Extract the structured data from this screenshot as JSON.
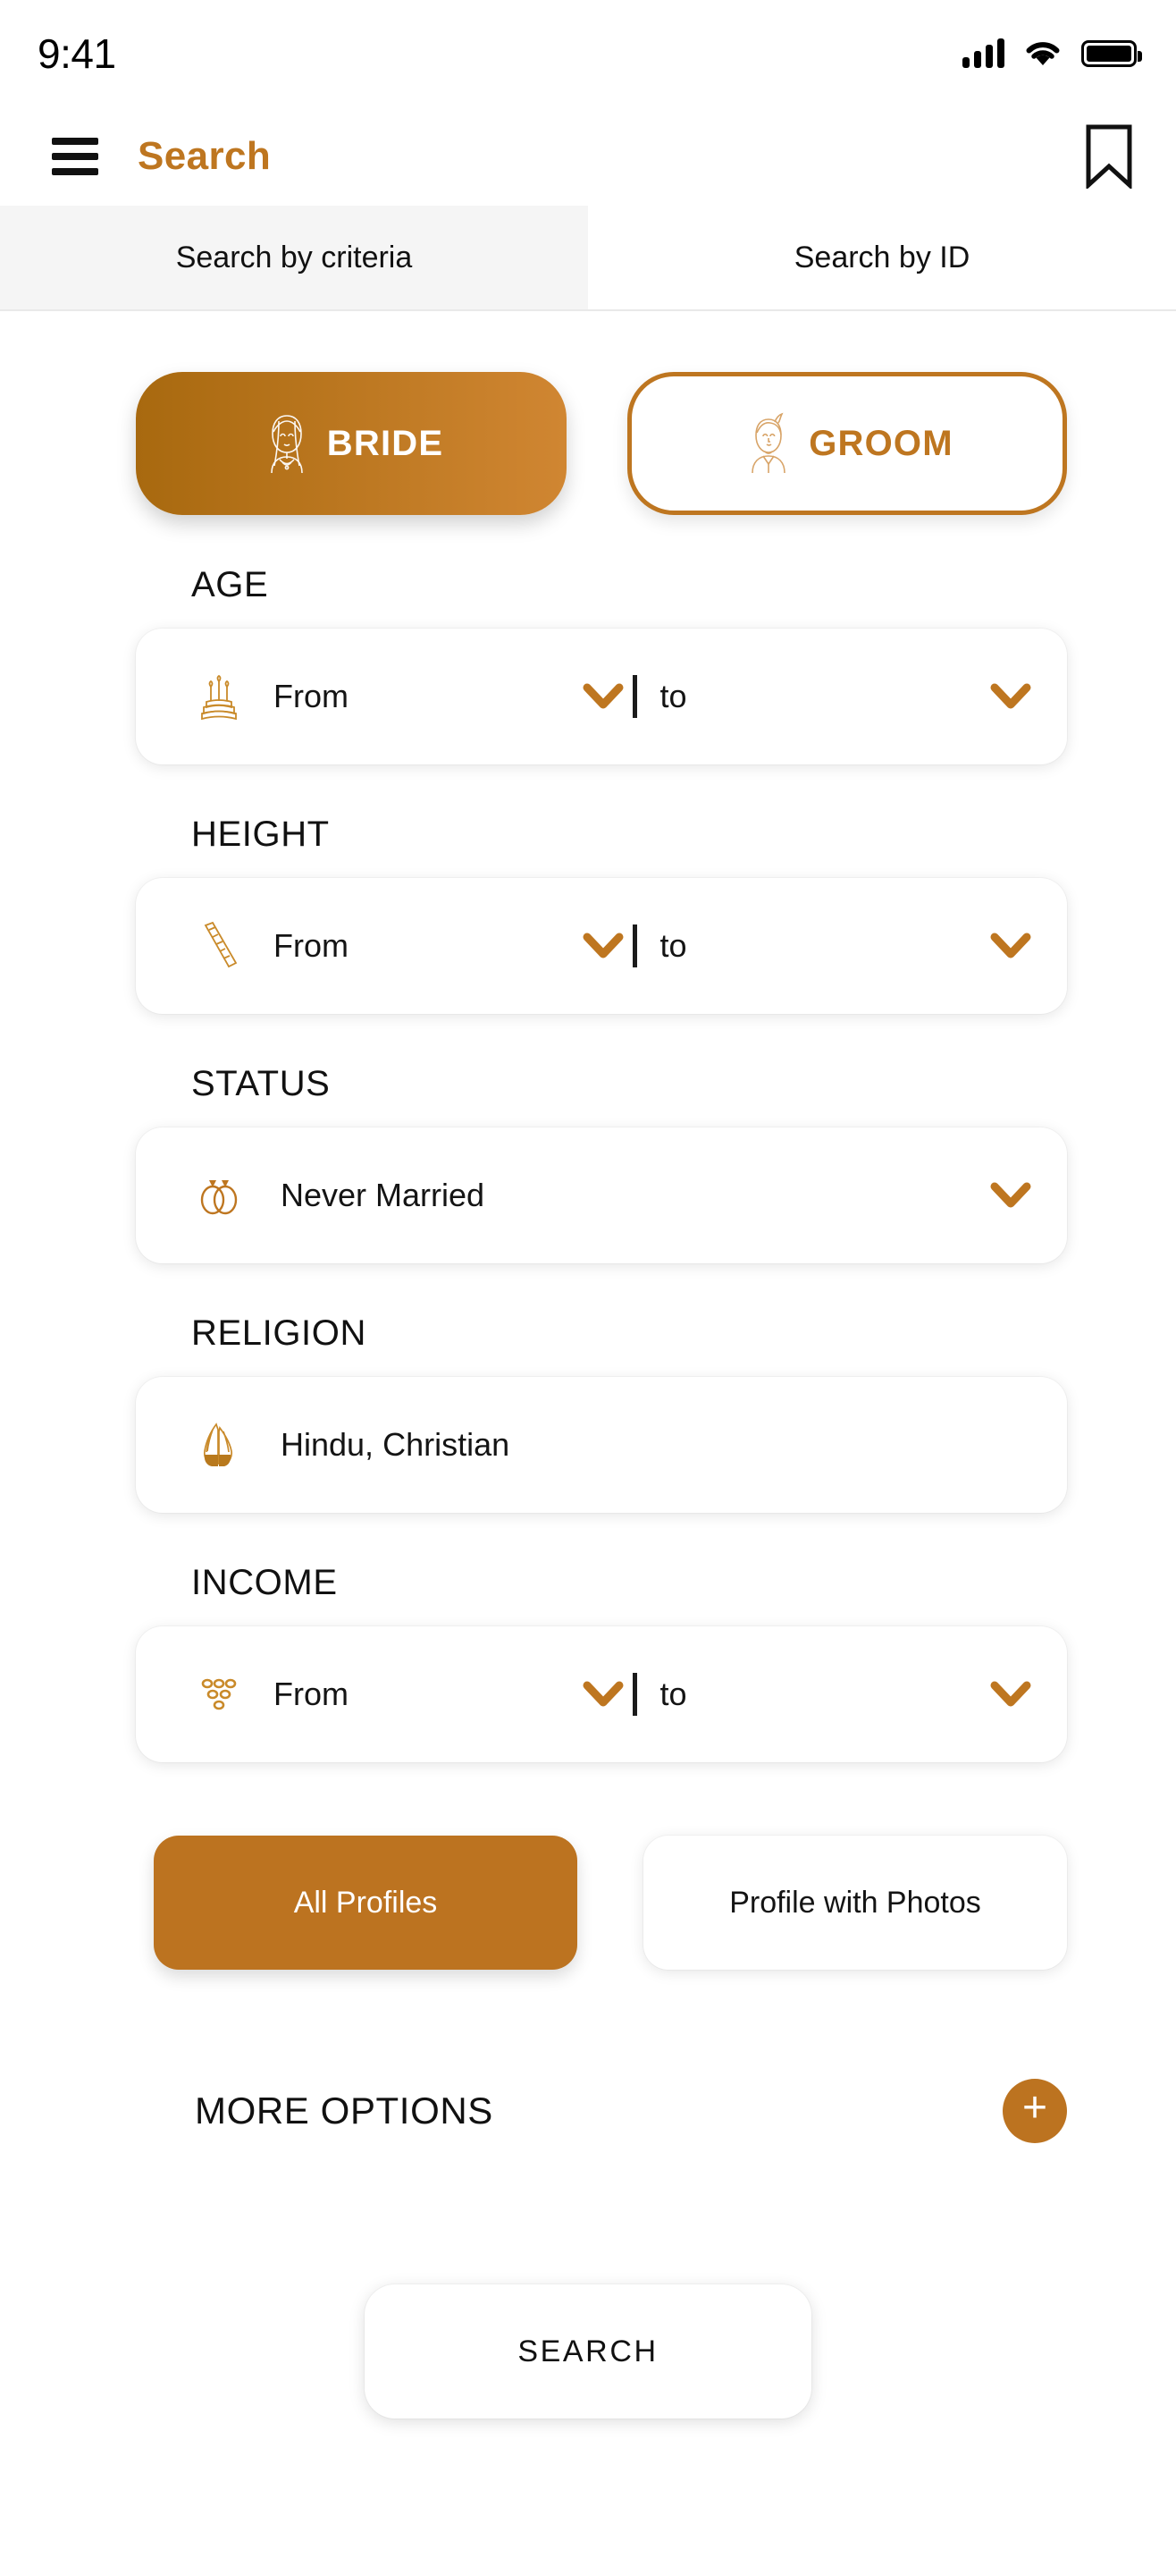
{
  "status_bar": {
    "time": "9:41",
    "signal_icon": "cellular-signal-icon",
    "wifi_icon": "wifi-icon",
    "battery_icon": "battery-full-icon"
  },
  "header": {
    "menu_icon": "hamburger-menu-icon",
    "title": "Search",
    "bookmark_icon": "bookmark-icon"
  },
  "tabs": [
    {
      "label": "Search by criteria",
      "active": true
    },
    {
      "label": "Search by ID",
      "active": false
    }
  ],
  "gender": {
    "bride": {
      "label": "BRIDE",
      "icon": "bride-icon",
      "selected": true
    },
    "groom": {
      "label": "GROOM",
      "icon": "groom-icon",
      "selected": false
    }
  },
  "fields": {
    "age": {
      "label": "AGE",
      "icon": "birthday-cake-icon",
      "from_placeholder": "From",
      "to_placeholder": "to"
    },
    "height": {
      "label": "HEIGHT",
      "icon": "ruler-icon",
      "from_placeholder": "From",
      "to_placeholder": "to"
    },
    "status": {
      "label": "STATUS",
      "icon": "wedding-rings-icon",
      "value": "Never Married"
    },
    "religion": {
      "label": "RELIGION",
      "icon": "praying-hands-icon",
      "value": "Hindu, Christian"
    },
    "income": {
      "label": "INCOME",
      "icon": "coins-icon",
      "from_placeholder": "From",
      "to_placeholder": "to"
    }
  },
  "profile_filters": [
    {
      "label": "All Profiles",
      "selected": true
    },
    {
      "label": "Profile with Photos",
      "selected": false
    }
  ],
  "more_options": {
    "label": "MORE OPTIONS",
    "add_icon": "plus-icon",
    "add_label": "+"
  },
  "search_button": {
    "label": "SEARCH"
  },
  "colors": {
    "accent": "#BE7620",
    "accent_solid": "#BC7320",
    "gradient_start": "#A8690F",
    "gradient_end": "#D08632",
    "tab_active_bg": "#F5F5F5",
    "text": "#141414"
  }
}
